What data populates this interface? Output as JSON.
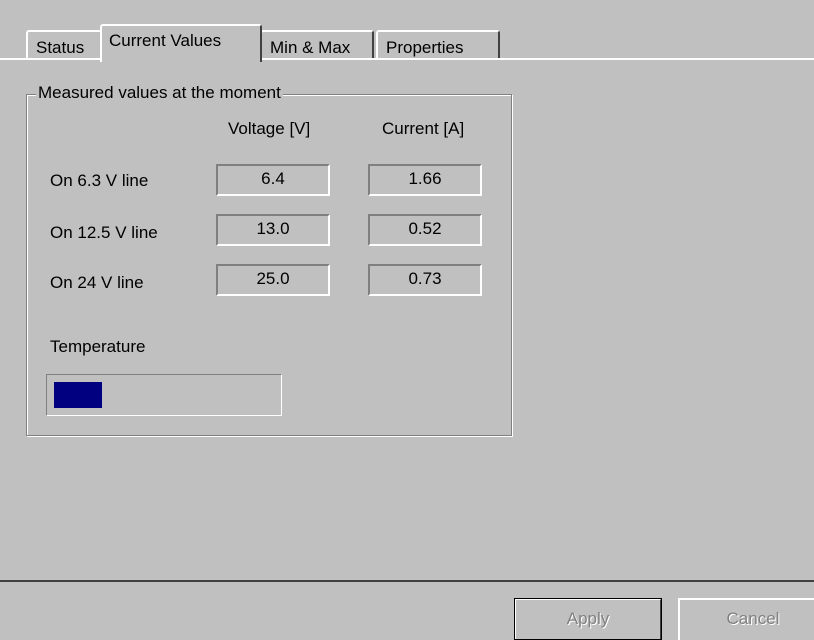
{
  "tabs": [
    "Status",
    "Current Values",
    "Min & Max",
    "Properties"
  ],
  "active_tab": "Current Values",
  "group": {
    "title": "Measured values at the moment",
    "col_voltage": "Voltage [V]",
    "col_current": "Current [A]",
    "rows": [
      {
        "label": "On 6.3 V line",
        "voltage": "6.4",
        "current": "1.66"
      },
      {
        "label": "On 12.5 V line",
        "voltage": "13.0",
        "current": "0.52"
      },
      {
        "label": "On 24 V line",
        "voltage": "25.0",
        "current": "0.73"
      }
    ],
    "temperature_label": "Temperature",
    "temperature_fraction": 0.22
  },
  "buttons": {
    "apply": "Apply",
    "cancel": "Cancel"
  },
  "colors": {
    "face": "#c0c0c0",
    "progress": "#000080",
    "disabled_text": "#808080"
  }
}
